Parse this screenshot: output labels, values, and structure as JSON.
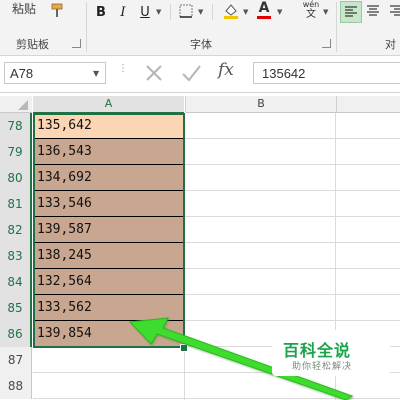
{
  "ribbon": {
    "clipboard_label": "粘贴",
    "clipboard_group": "剪贴板",
    "font_group": "字体",
    "align_group_partial": "对",
    "bold": "B",
    "italic": "I",
    "underline": "U",
    "font_color_glyph": "A",
    "phonetic_top": "wén",
    "phonetic_bottom": "文"
  },
  "formula_bar": {
    "name_box": "A78",
    "fx": "fx",
    "formula_value": "135642"
  },
  "columns": [
    "A",
    "B"
  ],
  "rows": [
    {
      "num": "78",
      "value": "135,642"
    },
    {
      "num": "79",
      "value": "136,543"
    },
    {
      "num": "80",
      "value": "134,692"
    },
    {
      "num": "81",
      "value": "133,546"
    },
    {
      "num": "82",
      "value": "139,587"
    },
    {
      "num": "83",
      "value": "138,245"
    },
    {
      "num": "84",
      "value": "132,564"
    },
    {
      "num": "85",
      "value": "133,562"
    },
    {
      "num": "86",
      "value": "139,854"
    },
    {
      "num": "87",
      "value": ""
    },
    {
      "num": "88",
      "value": ""
    }
  ],
  "colors": {
    "active_cell_fill": "#fcd5b4",
    "selected_fill": "#c9a690",
    "selection_border": "#1e7145",
    "arrow": "#3ddc2e",
    "watermark": "#1aa34a"
  },
  "watermark": {
    "title": "百科全说",
    "subtitle": "助你轻松解决"
  }
}
